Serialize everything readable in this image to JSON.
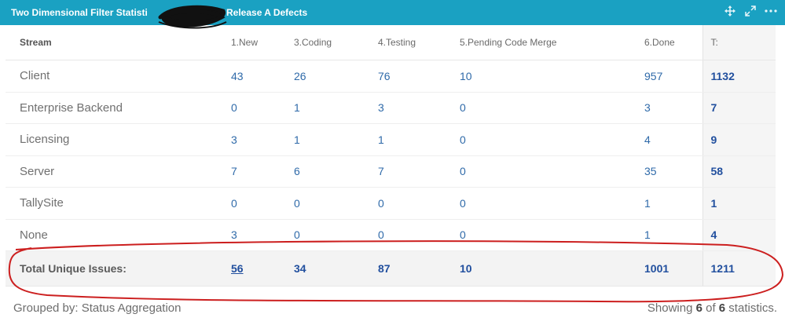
{
  "gadget": {
    "title_part1": "Two Dimensional Filter Statisti",
    "title_part2": "Release A Defects",
    "header_color": "#1aa1c2",
    "actions": [
      "move-icon",
      "expand-icon",
      "more-icon"
    ]
  },
  "table": {
    "columns": [
      "Stream",
      "1.New",
      "3.Coding",
      "4.Testing",
      "5.Pending Code Merge",
      "6.Done",
      "T:"
    ],
    "rows": [
      {
        "name": "Client",
        "values": [
          "43",
          "26",
          "76",
          "10",
          "957"
        ],
        "total": "1132"
      },
      {
        "name": "Enterprise Backend",
        "values": [
          "0",
          "1",
          "3",
          "0",
          "3"
        ],
        "total": "7"
      },
      {
        "name": "Licensing",
        "values": [
          "3",
          "1",
          "1",
          "0",
          "4"
        ],
        "total": "9"
      },
      {
        "name": "Server",
        "values": [
          "7",
          "6",
          "7",
          "0",
          "35"
        ],
        "total": "58"
      },
      {
        "name": "TallySite",
        "values": [
          "0",
          "0",
          "0",
          "0",
          "1"
        ],
        "total": "1"
      },
      {
        "name": "None",
        "values": [
          "3",
          "0",
          "0",
          "0",
          "1"
        ],
        "total": "4"
      }
    ],
    "totals_row": {
      "label": "Total Unique Issues:",
      "values": [
        "56",
        "34",
        "87",
        "10",
        "1001"
      ],
      "total": "1211"
    }
  },
  "footer": {
    "grouped_by": "Grouped by: Status Aggregation",
    "showing_prefix": "Showing ",
    "showing_count": "6",
    "showing_mid": " of ",
    "showing_total": "6",
    "showing_suffix": " statistics."
  },
  "annotation_color": "#cc1f1f"
}
